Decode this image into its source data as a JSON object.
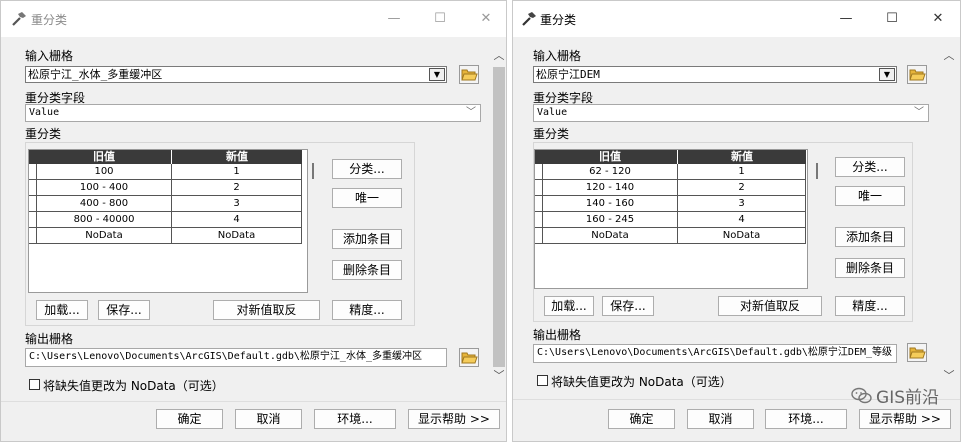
{
  "windows": [
    {
      "title": "重分类",
      "input_raster_label": "输入栅格",
      "input_raster_value": "松原宁江_水体_多重缓冲区",
      "reclass_field_label": "重分类字段",
      "reclass_field_value": "Value",
      "reclassification_label": "重分类",
      "table_headers": [
        "旧值",
        "新值"
      ],
      "rows": [
        {
          "old": "100",
          "new": "1"
        },
        {
          "old": "100 - 400",
          "new": "2"
        },
        {
          "old": "400 - 800",
          "new": "3"
        },
        {
          "old": "800 - 40000",
          "new": "4"
        },
        {
          "old": "NoData",
          "new": "NoData"
        }
      ],
      "classify_label": "分类...",
      "unique_label": "唯一",
      "add_entry_label": "添加条目",
      "delete_entry_label": "删除条目",
      "load_label": "加载...",
      "save_label": "保存...",
      "reverse_label": "对新值取反",
      "precision_label": "精度...",
      "output_raster_label": "输出栅格",
      "output_raster_value": "C:\\Users\\Lenovo\\Documents\\ArcGIS\\Default.gdb\\松原宁江_水体_多重缓冲区",
      "nodata_checkbox_label": "将缺失值更改为 NoData（可选）",
      "ok_label": "确定",
      "cancel_label": "取消",
      "env_label": "环境...",
      "help_label": "显示帮助 >>"
    },
    {
      "title": "重分类",
      "input_raster_label": "输入栅格",
      "input_raster_value": "松原宁江DEM",
      "reclass_field_label": "重分类字段",
      "reclass_field_value": "Value",
      "reclassification_label": "重分类",
      "table_headers": [
        "旧值",
        "新值"
      ],
      "rows": [
        {
          "old": "62 - 120",
          "new": "1"
        },
        {
          "old": "120 - 140",
          "new": "2"
        },
        {
          "old": "140 - 160",
          "new": "3"
        },
        {
          "old": "160 - 245",
          "new": "4"
        },
        {
          "old": "NoData",
          "new": "NoData"
        }
      ],
      "classify_label": "分类...",
      "unique_label": "唯一",
      "add_entry_label": "添加条目",
      "delete_entry_label": "删除条目",
      "load_label": "加载...",
      "save_label": "保存...",
      "reverse_label": "对新值取反",
      "precision_label": "精度...",
      "output_raster_label": "输出栅格",
      "output_raster_value": "C:\\Users\\Lenovo\\Documents\\ArcGIS\\Default.gdb\\松原宁江DEM_等级",
      "nodata_checkbox_label": "将缺失值更改为 NoData（可选）",
      "ok_label": "确定",
      "cancel_label": "取消",
      "env_label": "环境...",
      "help_label": "显示帮助 >>"
    }
  ],
  "window_controls": {
    "minimize": "—",
    "maximize": "☐",
    "close": "✕"
  },
  "watermark": "GIS前沿",
  "colors": {
    "header_bg": "#3a3a3a",
    "window_bg": "#f0f0f0",
    "titlebar_bg": "#ffffff"
  },
  "icons": [
    "hammer-icon",
    "folder-open-icon",
    "chevron-down-icon",
    "scroll-up-icon",
    "scroll-down-icon",
    "wechat-icon"
  ]
}
